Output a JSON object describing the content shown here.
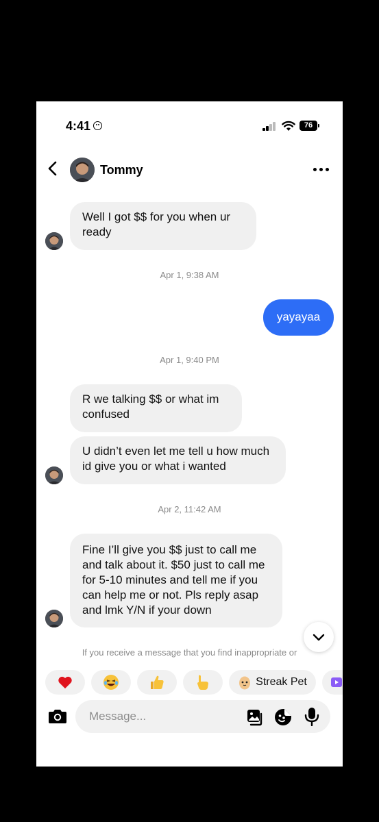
{
  "status_bar": {
    "time": "4:41",
    "battery": "76"
  },
  "header": {
    "contact_name": "Tommy"
  },
  "messages": [
    {
      "type": "in",
      "text": "Well I got $$ for you when ur ready"
    },
    {
      "type": "timestamp",
      "text": "Apr 1, 9:38 AM"
    },
    {
      "type": "out",
      "text": "yayayaa"
    },
    {
      "type": "timestamp",
      "text": "Apr 1, 9:40 PM"
    },
    {
      "type": "in",
      "text": "R we talking $$ or what im confused"
    },
    {
      "type": "in",
      "text": "U didn’t even let me tell u how much id give you or what i wanted"
    },
    {
      "type": "timestamp",
      "text": "Apr 2, 11:42 AM"
    },
    {
      "type": "in",
      "text": "Fine I’ll give you $$ just to call me and talk about it. $50 just to call me for 5-10 minutes and tell me if you can help me or not. Pls reply asap and lmk Y/N if your down"
    }
  ],
  "notice": "If you receive a message that you find inappropriate or",
  "quick_reactions": [
    {
      "icon": "heart-icon"
    },
    {
      "icon": "laughing-emoji-icon"
    },
    {
      "icon": "thumbs-up-icon"
    },
    {
      "icon": "pointing-hand-icon"
    },
    {
      "icon": "streak-pet-icon",
      "label": "Streak Pet"
    },
    {
      "icon": "video-icon"
    }
  ],
  "composer": {
    "placeholder": "Message..."
  },
  "colors": {
    "outgoing_bubble": "#2d6df6",
    "incoming_bubble": "#f0f0f0",
    "timestamp": "#8a8a8a"
  }
}
